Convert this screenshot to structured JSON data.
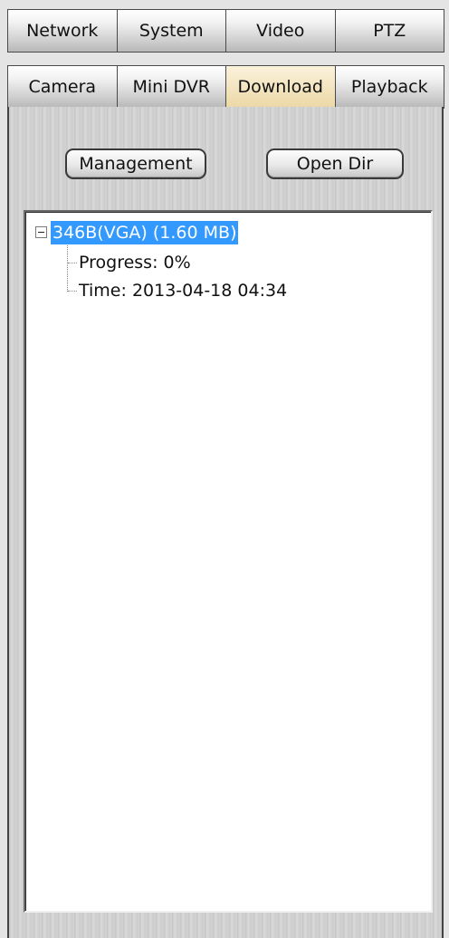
{
  "tabs_row1": [
    "Network",
    "System",
    "Video",
    "PTZ"
  ],
  "tabs_row2": [
    "Camera",
    "Mini DVR",
    "Download",
    "Playback"
  ],
  "active_tab": "Download",
  "buttons": {
    "management": "Management",
    "open_dir": "Open Dir"
  },
  "tree": {
    "root": "346B(VGA) (1.60 MB)",
    "progress": "Progress: 0%",
    "time": "Time: 2013-04-18 04:34"
  },
  "colors": {
    "selection": "#3399ff",
    "active_tab": "#f3e4bd"
  }
}
